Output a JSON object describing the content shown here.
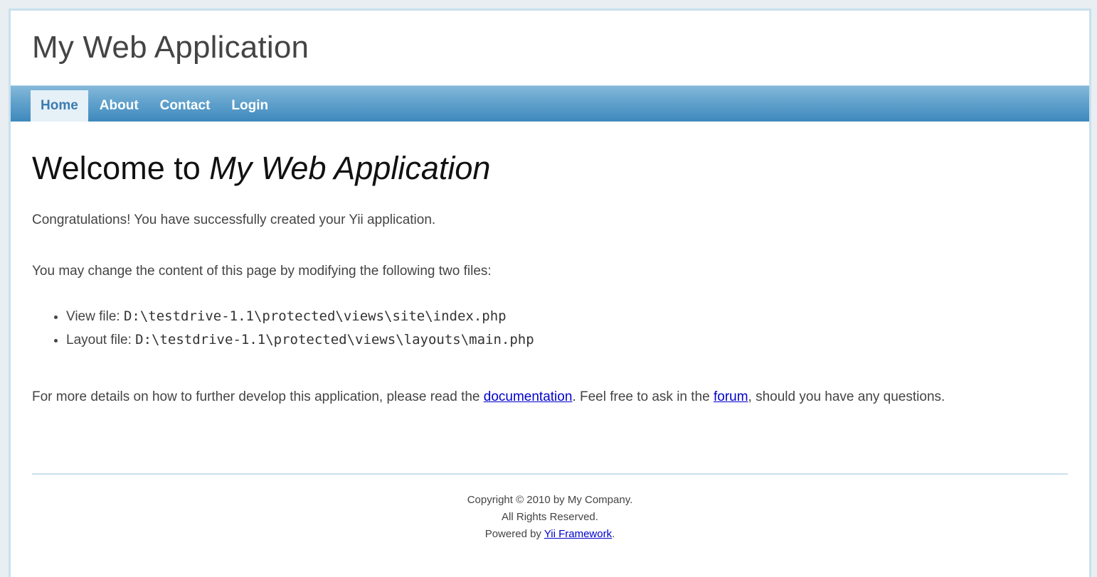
{
  "header": {
    "logo_text": "My Web Application"
  },
  "mainmenu": {
    "items": [
      {
        "label": "Home",
        "active": true
      },
      {
        "label": "About",
        "active": false
      },
      {
        "label": "Contact",
        "active": false
      },
      {
        "label": "Login",
        "active": false
      }
    ]
  },
  "content": {
    "title_prefix": "Welcome to ",
    "title_app": "My Web Application",
    "congrats": "Congratulations! You have successfully created your Yii application.",
    "change_intro": "You may change the content of this page by modifying the following two files:",
    "files": [
      {
        "label": "View file: ",
        "path": "D:\\testdrive-1.1\\protected\\views\\site\\index.php"
      },
      {
        "label": "Layout file: ",
        "path": "D:\\testdrive-1.1\\protected\\views\\layouts\\main.php"
      }
    ],
    "details_before": "For more details on how to further develop this application, please read the ",
    "details_link": "documentation",
    "details_middle": ". Feel free to ask in the ",
    "forum_link": "forum",
    "details_after": ", should you have any questions."
  },
  "footer": {
    "copyright": "Copyright © 2010 by My Company.",
    "rights": "All Rights Reserved.",
    "powered_prefix": "Powered by ",
    "powered_link": "Yii Framework",
    "powered_suffix": "."
  },
  "colors": {
    "menu_gradient_top": "#84b9d9",
    "menu_gradient_bottom": "#3f88bd",
    "active_tab_bg": "#e6f0f7",
    "link": "#0000cc",
    "border": "#c9e0ed"
  }
}
